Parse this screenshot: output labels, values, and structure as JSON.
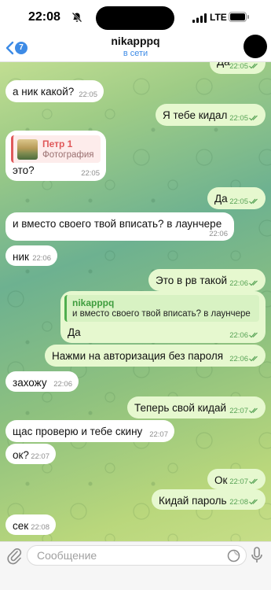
{
  "status_bar": {
    "time": "22:08",
    "network": "LTE"
  },
  "header": {
    "back_badge": "7",
    "title": "nikapppq",
    "status": "в сети"
  },
  "messages": [
    {
      "id": "m0",
      "dir": "out",
      "text": "Да",
      "time": "22:05",
      "read": true
    },
    {
      "id": "m1",
      "dir": "in",
      "text": "а ник какой?",
      "time": "22:05"
    },
    {
      "id": "m2",
      "dir": "out",
      "text": "Я тебе кидал",
      "time": "22:05",
      "read": true
    },
    {
      "id": "m3",
      "dir": "in",
      "text": "это?",
      "time": "22:05",
      "reply": {
        "name": "Петр 1",
        "subtitle": "Фотография"
      }
    },
    {
      "id": "m4",
      "dir": "out",
      "text": "Да",
      "time": "22:05",
      "read": true
    },
    {
      "id": "m5",
      "dir": "in",
      "text": "и вместо своего твой вписать? в лаунчере",
      "time": "22:06"
    },
    {
      "id": "m6",
      "dir": "in",
      "text": "ник",
      "time": "22:06"
    },
    {
      "id": "m7",
      "dir": "out",
      "text": "Это в рв такой",
      "time": "22:06",
      "read": true
    },
    {
      "id": "m8",
      "dir": "out",
      "text": "Да",
      "time": "22:06",
      "read": true,
      "reply": {
        "name": "nikapppq",
        "subtitle": "и вместо своего твой вписать? в лаунчере"
      }
    },
    {
      "id": "m9",
      "dir": "out",
      "text": "Нажми на авторизация без пароля",
      "time": "22:06",
      "read": true
    },
    {
      "id": "m10",
      "dir": "in",
      "text": "захожу",
      "time": "22:06"
    },
    {
      "id": "m11",
      "dir": "out",
      "text": "Теперь свой кидай",
      "time": "22:07",
      "read": true
    },
    {
      "id": "m12",
      "dir": "in",
      "text": "щас проверю и тебе скину",
      "time": "22:07"
    },
    {
      "id": "m13",
      "dir": "in",
      "text": "ок?",
      "time": "22:07"
    },
    {
      "id": "m14",
      "dir": "out",
      "text": "Ок",
      "time": "22:07",
      "read": true
    },
    {
      "id": "m15",
      "dir": "out",
      "text": "Кидай пароль",
      "time": "22:08",
      "read": true
    },
    {
      "id": "m16",
      "dir": "in",
      "text": "сек",
      "time": "22:08"
    }
  ],
  "composer": {
    "placeholder": "Сообщение"
  },
  "colors": {
    "accent": "#3d8be6",
    "outgoing_bubble": "#e6f8cf",
    "incoming_bubble": "#ffffff",
    "read_check": "#58a356"
  }
}
